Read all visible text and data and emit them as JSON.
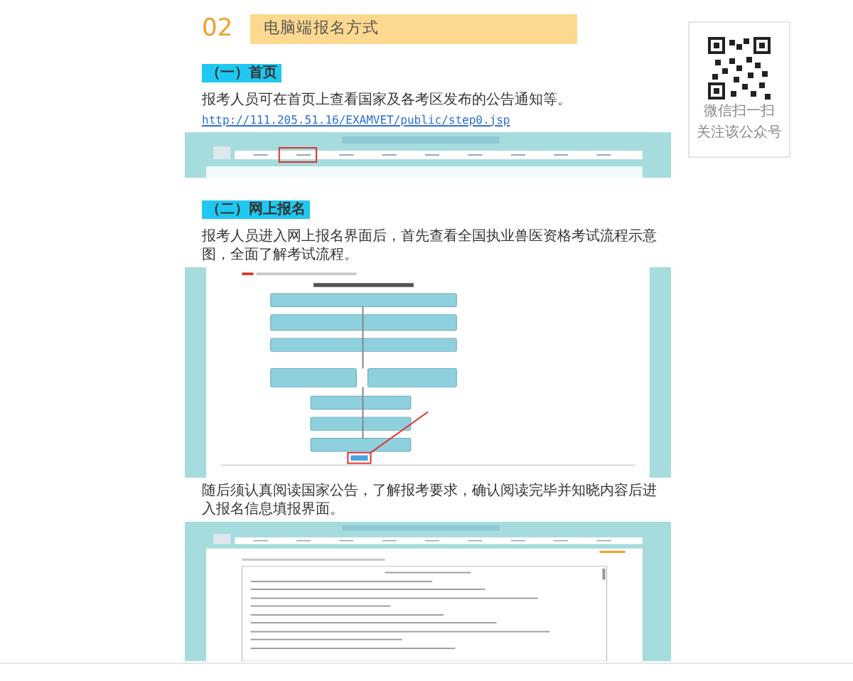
{
  "section_number": "02",
  "section_title": "电脑端报名方式",
  "content": [
    {
      "kind": "tag",
      "text": "（一）首页"
    },
    {
      "kind": "paragraph",
      "text": "报考人员可在首页上查看国家及各考区发布的公告通知等。"
    },
    {
      "kind": "link",
      "text": "http://111.205.51.16/EXAMVET/public/step0.jsp"
    },
    {
      "kind": "homepage"
    },
    {
      "kind": "tag",
      "text": "（二）网上报名"
    },
    {
      "kind": "paragraph",
      "text": "报考人员进入网上报名界面后，首先查看全国执业兽医资格考试流程示意图，全面了解考试流程。"
    },
    {
      "kind": "flowchart"
    },
    {
      "kind": "paragraph",
      "text": "随后须认真阅读国家公告，了解报考要求，确认阅读完毕并知晓内容后进入报名信息填报界面。"
    },
    {
      "kind": "notice"
    }
  ],
  "qr": {
    "captions": [
      "微信扫一扫",
      "关注该公众号"
    ]
  }
}
